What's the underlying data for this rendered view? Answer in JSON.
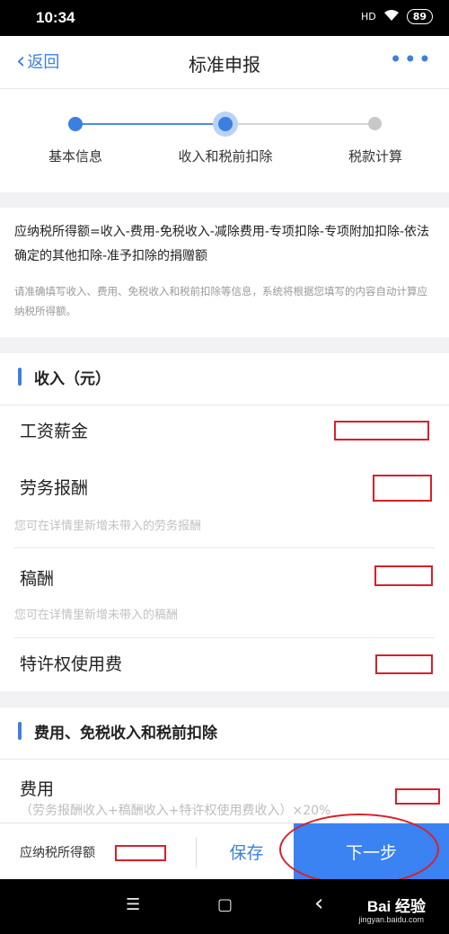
{
  "status": {
    "time": "10:34",
    "signal": "HD",
    "battery": "89"
  },
  "nav": {
    "back_label": "返回",
    "title": "标准申报",
    "more": "•••"
  },
  "steps": [
    {
      "label": "基本信息",
      "state": "done"
    },
    {
      "label": "收入和税前扣除",
      "state": "current"
    },
    {
      "label": "税款计算",
      "state": "pending"
    }
  ],
  "formula": {
    "text": "应纳税所得额=收入-费用-免税收入-减除费用-专项扣除-专项附加扣除-依法确定的其他扣除-准予扣除的捐赠额",
    "note": "请准确填写收入、费用、免税收入和税前扣除等信息，系统将根据您填写的内容自动计算应纳税所得额。"
  },
  "income": {
    "title": "收入（元）",
    "rows": [
      {
        "label": "工资薪金",
        "hint": ""
      },
      {
        "label": "劳务报酬",
        "hint": "您可在详情里新增未带入的劳务报酬"
      },
      {
        "label": "稿酬",
        "hint": "您可在详情里新增未带入的稿酬"
      },
      {
        "label": "特许权使用费",
        "hint": ""
      }
    ]
  },
  "deductions": {
    "title": "费用、免税收入和税前扣除",
    "fee_label": "费用",
    "fee_hint": "（劳务报酬收入+稿酬收入+特许权使用费收入）×20%"
  },
  "bottom": {
    "taxable_label": "应纳税所得额",
    "save_label": "保存",
    "next_label": "下一步"
  },
  "sysnav": {
    "menu": "☰",
    "home": "▢",
    "back": "‹"
  },
  "watermark": {
    "brand": "Bai  经验",
    "url": "jingyan.baidu.com"
  },
  "colors": {
    "accent": "#3b7fe0",
    "primary_button": "#3b82f2",
    "redaction": "#d8202a"
  }
}
